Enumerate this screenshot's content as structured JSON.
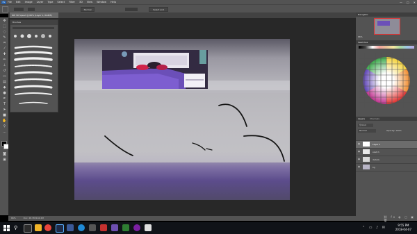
{
  "app": {
    "logo": "Ps",
    "menus": [
      "File",
      "Edit",
      "Image",
      "Layer",
      "Type",
      "Select",
      "Filter",
      "3D",
      "View",
      "Window",
      "Help"
    ]
  },
  "window_controls": [
    "—",
    "□",
    "✕"
  ],
  "options_bar": {
    "mode_value": "Normal",
    "select_button": "Select and Mask..."
  },
  "document_tab": "IBE 3D Speed @ 66% (Layer 1, RGB/8)",
  "brush_panel": {
    "title": "Brushes"
  },
  "status_bar": {
    "zoom": "66%",
    "doc_info": "Doc: 28.3M/104.2M"
  },
  "right_panels": {
    "navigator_title": "Navigator",
    "nav_zoom": "66%",
    "swatches_title": "Swatches",
    "layers_tab": "Layers",
    "channels_tab": "Channels",
    "blend_mode": "Normal",
    "opacity_label": "Opacity: 100%",
    "layers": [
      "Layer 1",
      "sketch",
      "details",
      "bg"
    ]
  },
  "colors": {
    "menubar": "#535353",
    "canvas_bg": "#282828",
    "taskbar": "#101318",
    "accent_purple": "#6d4fb0"
  },
  "clock": {
    "time": "9:55 PM",
    "date": "2018-04-07"
  }
}
